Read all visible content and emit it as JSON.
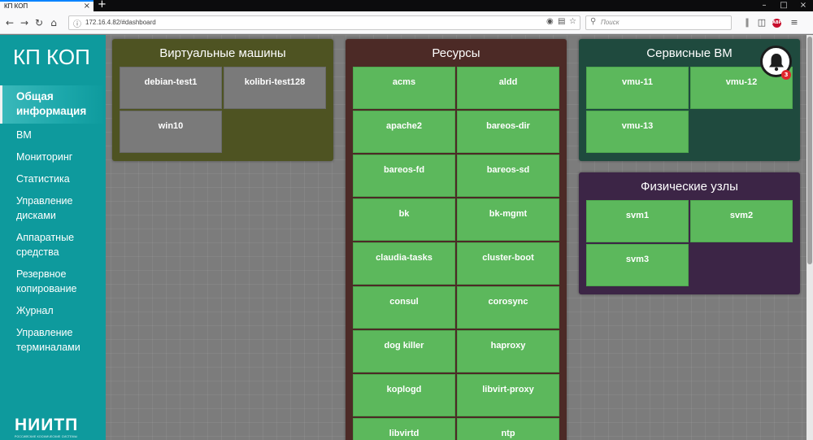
{
  "browser": {
    "tab_title": "КП КОП",
    "tab_close": "×",
    "new_tab": "+",
    "url": "172.16.4.82/#dashboard",
    "search_placeholder": "Поиск",
    "abp_label": "ABP"
  },
  "sidebar": {
    "brand": "КП КОП",
    "items": [
      {
        "label": "Общая информация",
        "active": true
      },
      {
        "label": "ВМ"
      },
      {
        "label": "Мониторинг"
      },
      {
        "label": "Статистика"
      },
      {
        "label": "Управление дисками"
      },
      {
        "label": "Аппаратные средства"
      },
      {
        "label": "Резервное копирование"
      },
      {
        "label": "Журнал"
      },
      {
        "label": "Управление терминалами"
      }
    ],
    "logo": "НИИТП",
    "logo_sub": "РОССИЙСКИЕ КОСМИЧЕСКИЕ СИСТЕМЫ"
  },
  "panels": {
    "vms": {
      "title": "Виртуальные машины",
      "color": "#4e5322",
      "items": [
        "debian-test1",
        "kolibri-test128",
        "win10"
      ]
    },
    "resources": {
      "title": "Ресурсы",
      "color": "#4c2a26",
      "items": [
        "acms",
        "aldd",
        "apache2",
        "bareos-dir",
        "bareos-fd",
        "bareos-sd",
        "bk",
        "bk-mgmt",
        "claudia-tasks",
        "cluster-boot",
        "consul",
        "corosync",
        "dog killer",
        "haproxy",
        "koplogd",
        "libvirt-proxy",
        "libvirtd",
        "ntp"
      ]
    },
    "service_vms": {
      "title": "Сервисные ВМ",
      "color": "#1f4a3e",
      "items": [
        "vmu-11",
        "vmu-12",
        "vmu-13"
      ]
    },
    "physical": {
      "title": "Физические узлы",
      "color": "#3c2546",
      "items": [
        "svm1",
        "svm2",
        "svm3"
      ]
    }
  },
  "notifications": {
    "count": "3",
    "icon": "bell-icon"
  },
  "colors": {
    "sidebar": "#0e9a9d",
    "tile_green": "#5cb85c",
    "tile_grey": "#7a7a7a",
    "badge": "#e0262c"
  }
}
